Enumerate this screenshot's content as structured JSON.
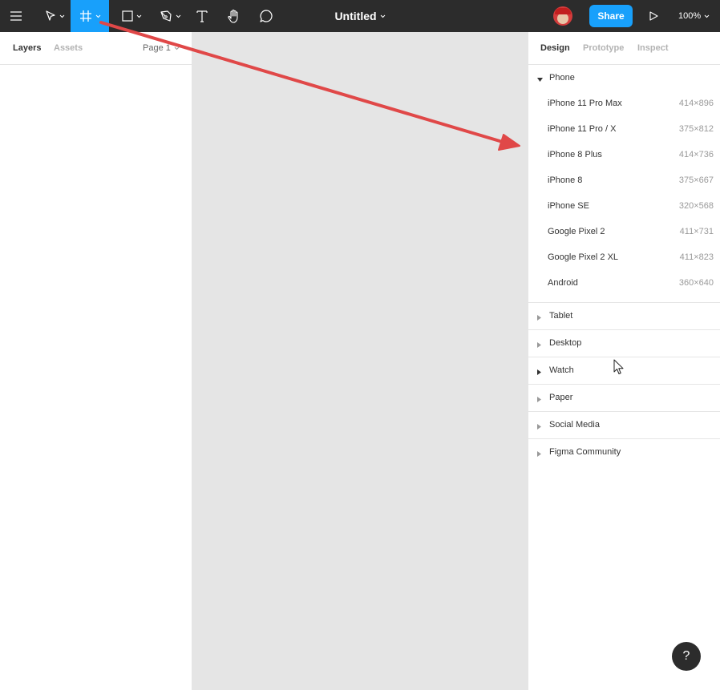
{
  "toolbar": {
    "title": "Untitled",
    "share_label": "Share",
    "zoom": "100%",
    "active_tool": "frame",
    "accent_color": "#18a0fb"
  },
  "left_panel": {
    "tabs": [
      "Layers",
      "Assets"
    ],
    "page_selector": "Page 1"
  },
  "right_panel": {
    "tabs": [
      "Design",
      "Prototype",
      "Inspect"
    ],
    "phone": {
      "label": "Phone",
      "expanded": true,
      "devices": [
        {
          "name": "iPhone 11 Pro Max",
          "size": "414×896"
        },
        {
          "name": "iPhone 11 Pro / X",
          "size": "375×812"
        },
        {
          "name": "iPhone 8 Plus",
          "size": "414×736"
        },
        {
          "name": "iPhone 8",
          "size": "375×667"
        },
        {
          "name": "iPhone SE",
          "size": "320×568"
        },
        {
          "name": "Google Pixel 2",
          "size": "411×731"
        },
        {
          "name": "Google Pixel 2 XL",
          "size": "411×823"
        },
        {
          "name": "Android",
          "size": "360×640"
        }
      ]
    },
    "categories": [
      "Tablet",
      "Desktop",
      "Watch",
      "Paper",
      "Social Media",
      "Figma Community"
    ]
  },
  "help": {
    "label": "?"
  },
  "annotation": {
    "arrow_color": "#e04848"
  }
}
